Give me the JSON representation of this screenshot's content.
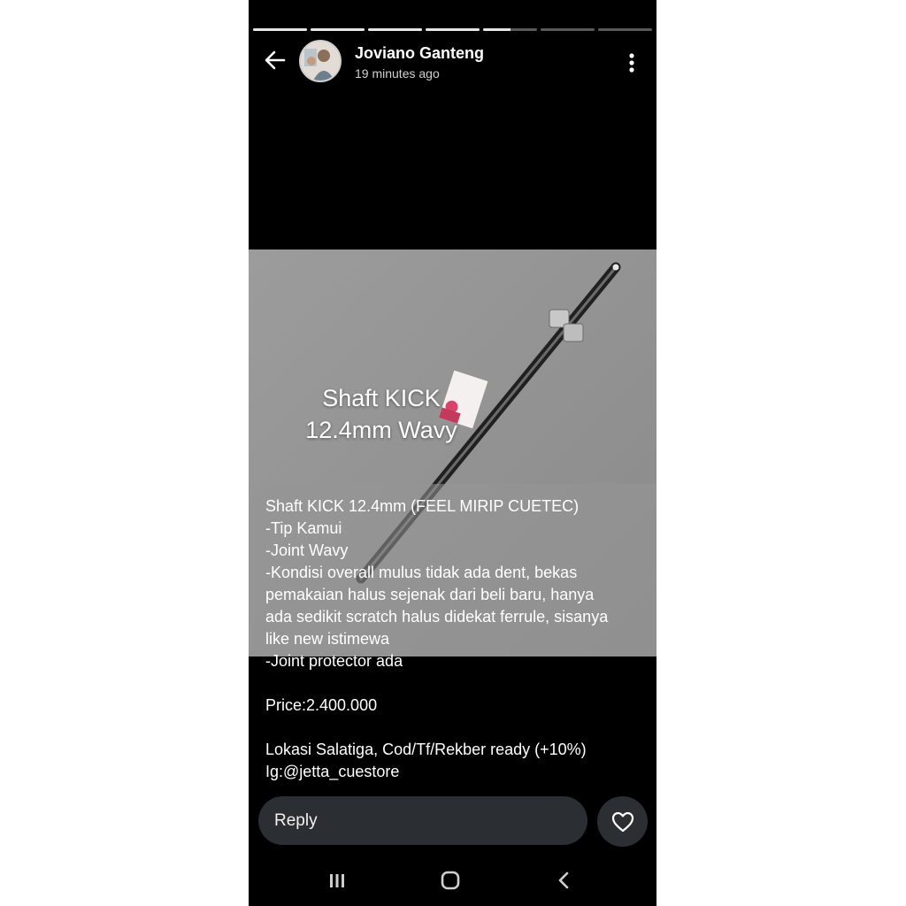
{
  "story": {
    "segments": [
      {
        "progress": 1.0
      },
      {
        "progress": 1.0
      },
      {
        "progress": 1.0
      },
      {
        "progress": 1.0
      },
      {
        "progress": 0.5
      },
      {
        "progress": 0.0
      },
      {
        "progress": 0.0
      }
    ]
  },
  "header": {
    "username": "Joviano Ganteng",
    "time": "19 minutes ago"
  },
  "photo": {
    "sticker_line1": "Shaft KICK",
    "sticker_line2": "12.4mm Wavy"
  },
  "caption": {
    "lines": [
      "Shaft KICK 12.4mm (FEEL MIRIP CUETEC)",
      "-Tip Kamui",
      "-Joint Wavy",
      "-Kondisi overall mulus tidak ada dent, bekas",
      "pemakaian halus sejenak dari beli baru, hanya",
      "ada sedikit scratch halus didekat ferrule, sisanya",
      "like new istimewa",
      "-Joint protector ada",
      "",
      "Price:2.400.000",
      "",
      "Lokasi Salatiga, Cod/Tf/Rekber ready (+10%)",
      "Ig:@jetta_cuestore"
    ]
  },
  "reply": {
    "placeholder": "Reply"
  },
  "icons": {
    "back": "arrow-left",
    "more": "vertical-dots",
    "like": "heart-outline",
    "nav_recents": "three-bars",
    "nav_home": "rounded-square",
    "nav_back": "chevron-left"
  },
  "colors": {
    "background": "#000000",
    "reply_bg": "#2b2e33",
    "text": "#ffffff"
  }
}
